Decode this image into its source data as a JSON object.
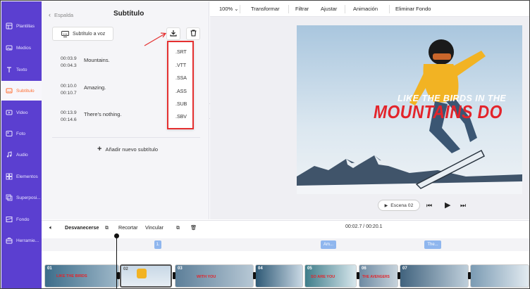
{
  "sidebar": {
    "items": [
      {
        "label": "Plantillas",
        "icon": "templates-icon"
      },
      {
        "label": "Medios",
        "icon": "media-icon"
      },
      {
        "label": "Texto",
        "icon": "text-icon"
      },
      {
        "label": "Subtítulo",
        "icon": "subtitle-icon",
        "active": true
      },
      {
        "label": "Video",
        "icon": "video-icon"
      },
      {
        "label": "Foto",
        "icon": "photo-icon"
      },
      {
        "label": "Audio",
        "icon": "audio-icon"
      },
      {
        "label": "Elementos",
        "icon": "elements-icon"
      },
      {
        "label": "Superposi...",
        "icon": "overlay-icon"
      },
      {
        "label": "Fondo",
        "icon": "background-icon"
      },
      {
        "label": "Herramie...",
        "icon": "tools-icon"
      }
    ]
  },
  "panel": {
    "back_label": "Espalda",
    "title": "Subtítulo",
    "voice_button": "Subtítulo a voz",
    "subtitles": [
      {
        "start": "00:03.9",
        "end": "00:04.3",
        "text": "Mountains."
      },
      {
        "start": "00:10.0",
        "end": "00:10.7",
        "text": "Amazing."
      },
      {
        "start": "00:13.9",
        "end": "00:14.6",
        "text": "There's nothing."
      }
    ],
    "add_label": "Añadir nuevo subtítulo"
  },
  "export_menu": {
    "options": [
      ".SRT",
      ".VTT",
      ".SSA",
      ".ASS",
      ".SUB",
      ".SBV"
    ]
  },
  "toolbar": {
    "zoom": "100%",
    "items": [
      "Transformar",
      "Filtrar",
      "Ajustar",
      "Animación",
      "Eliminar Fondo"
    ]
  },
  "video": {
    "line1": "LIKE THE BIRDS IN THE",
    "line2": "MOUNTAINS DO"
  },
  "player": {
    "scene_label": "Escena 02"
  },
  "timeline": {
    "fade_label": "Desvanecerse",
    "crop_label": "Recortar",
    "link_label": "Vincular",
    "time": "00:02.7 / 00:20.1",
    "chips": [
      "1.",
      "Am...",
      "The..."
    ],
    "clips": [
      {
        "num": "01",
        "caption": "LIKE THE BIRDS"
      },
      {
        "num": "02",
        "caption": ""
      },
      {
        "num": "03",
        "caption": "WITH YOU"
      },
      {
        "num": "04",
        "caption": ""
      },
      {
        "num": "05",
        "caption": "SO ARE YOU"
      },
      {
        "num": "06",
        "caption": "THE AVENGERS"
      },
      {
        "num": "07",
        "caption": ""
      }
    ]
  },
  "colors": {
    "rail": "#5b3fd0",
    "accent": "#ff6a2b",
    "highlight": "#e53030",
    "title_red": "#e3242b"
  }
}
